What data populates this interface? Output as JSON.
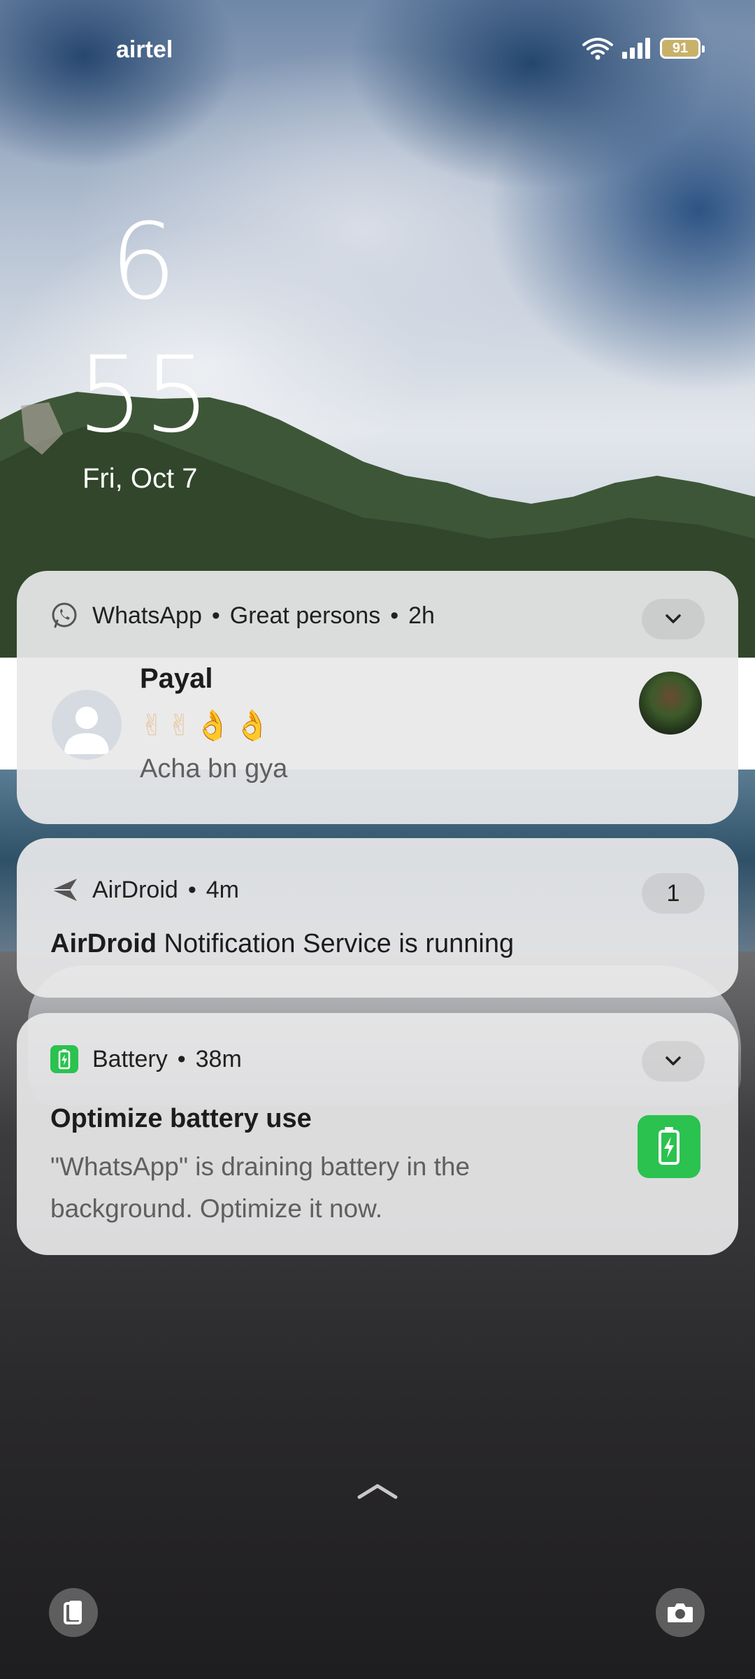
{
  "status_bar": {
    "carrier": "airtel",
    "battery_level": "91",
    "wifi_icon": "wifi-icon",
    "signal_icon": "cell-signal-icon"
  },
  "lockscreen": {
    "hour": "6",
    "minute": "55",
    "date": "Fri, Oct 7"
  },
  "notifications": [
    {
      "app": "WhatsApp",
      "group": "Great persons",
      "time": "2h",
      "icon": "whatsapp-icon",
      "sender": "Payal",
      "emoji_line": "✌✌👌👌",
      "message": "Acha bn gya"
    },
    {
      "app": "AirDroid",
      "time": "4m",
      "icon": "airdroid-icon",
      "count": "1",
      "body_app": "AirDroid",
      "body_text": " Notification Service is running"
    },
    {
      "app": "Battery",
      "time": "38m",
      "icon": "battery-icon",
      "title": "Optimize battery use",
      "text": "\"WhatsApp\" is draining battery in the background. Optimize it now."
    }
  ],
  "colors": {
    "battery_green": "#2bc24f",
    "card_bg": "#e8e8ea"
  },
  "bottom": {
    "left_icon": "wallet-icon",
    "right_icon": "camera-icon",
    "swipe_icon": "chevron-up-icon"
  }
}
